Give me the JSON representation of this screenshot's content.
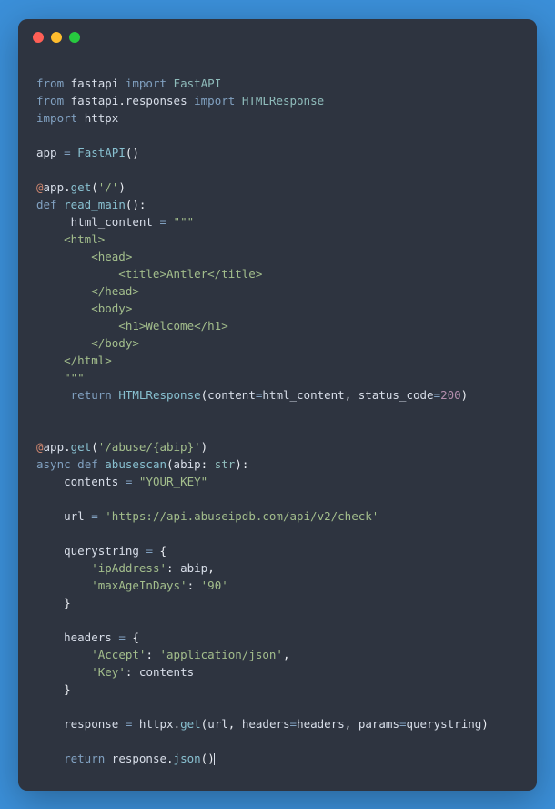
{
  "code": {
    "line1_from": "from",
    "line1_mod": "fastapi",
    "line1_import": "import",
    "line1_items": "FastAPI",
    "line2_from": "from",
    "line2_mod": "fastapi",
    "line2_dot": ".",
    "line2_sub": "responses",
    "line2_import": "import",
    "line2_items": "HTMLResponse",
    "line3_import": "import",
    "line3_mod": "httpx",
    "app_var": "app",
    "eq": "=",
    "fastapi_call": "FastAPI",
    "lparen": "(",
    "rparen": ")",
    "at": "@",
    "app_ref": "app",
    "dot": ".",
    "get": "get",
    "route_root": "'/'",
    "def": "def",
    "read_main": "read_main",
    "empty_params": "()",
    "colon": ":",
    "html_var": "html_content",
    "triple_open": "\"\"\"",
    "html_l1": "    <html>",
    "html_l2": "        <head>",
    "html_l3": "            <title>Antler</title>",
    "html_l4": "        </head>",
    "html_l5": "        <body>",
    "html_l6": "            <h1>Welcome</h1>",
    "html_l7": "        </body>",
    "html_l8": "    </html>",
    "triple_close": "    \"\"\"",
    "return": "return",
    "htmlresp": "HTMLResponse",
    "content_kw": "content",
    "status_kw": "status_code",
    "status_val": "200",
    "comma": ",",
    "route_abuse": "'/abuse/{abip}'",
    "async": "async",
    "abusescan": "abusescan",
    "abip_param": "abip",
    "str_type": "str",
    "contents_var": "contents",
    "your_key": "\"YOUR_KEY\"",
    "url_var": "url",
    "url_val": "'https://api.abuseipdb.com/api/v2/check'",
    "querystring_var": "querystring",
    "lbrace": "{",
    "rbrace": "}",
    "ip_key": "'ipAddress'",
    "abip_ref": "abip",
    "maxage_key": "'maxAgeInDays'",
    "maxage_val": "'90'",
    "headers_var": "headers",
    "accept_key": "'Accept'",
    "accept_val": "'application/json'",
    "key_key": "'Key'",
    "contents_ref": "contents",
    "response_var": "response",
    "httpx_ref": "httpx",
    "get_fn": "get",
    "url_ref": "url",
    "headers_kw": "headers",
    "headers_ref": "headers",
    "params_kw": "params",
    "querystring_ref": "querystring",
    "json_fn": "json"
  },
  "colors": {
    "bg": "#3b8fd8",
    "editor_bg": "#2e3440",
    "close": "#ff5f56",
    "min": "#ffbd2e",
    "max": "#27c93f"
  }
}
